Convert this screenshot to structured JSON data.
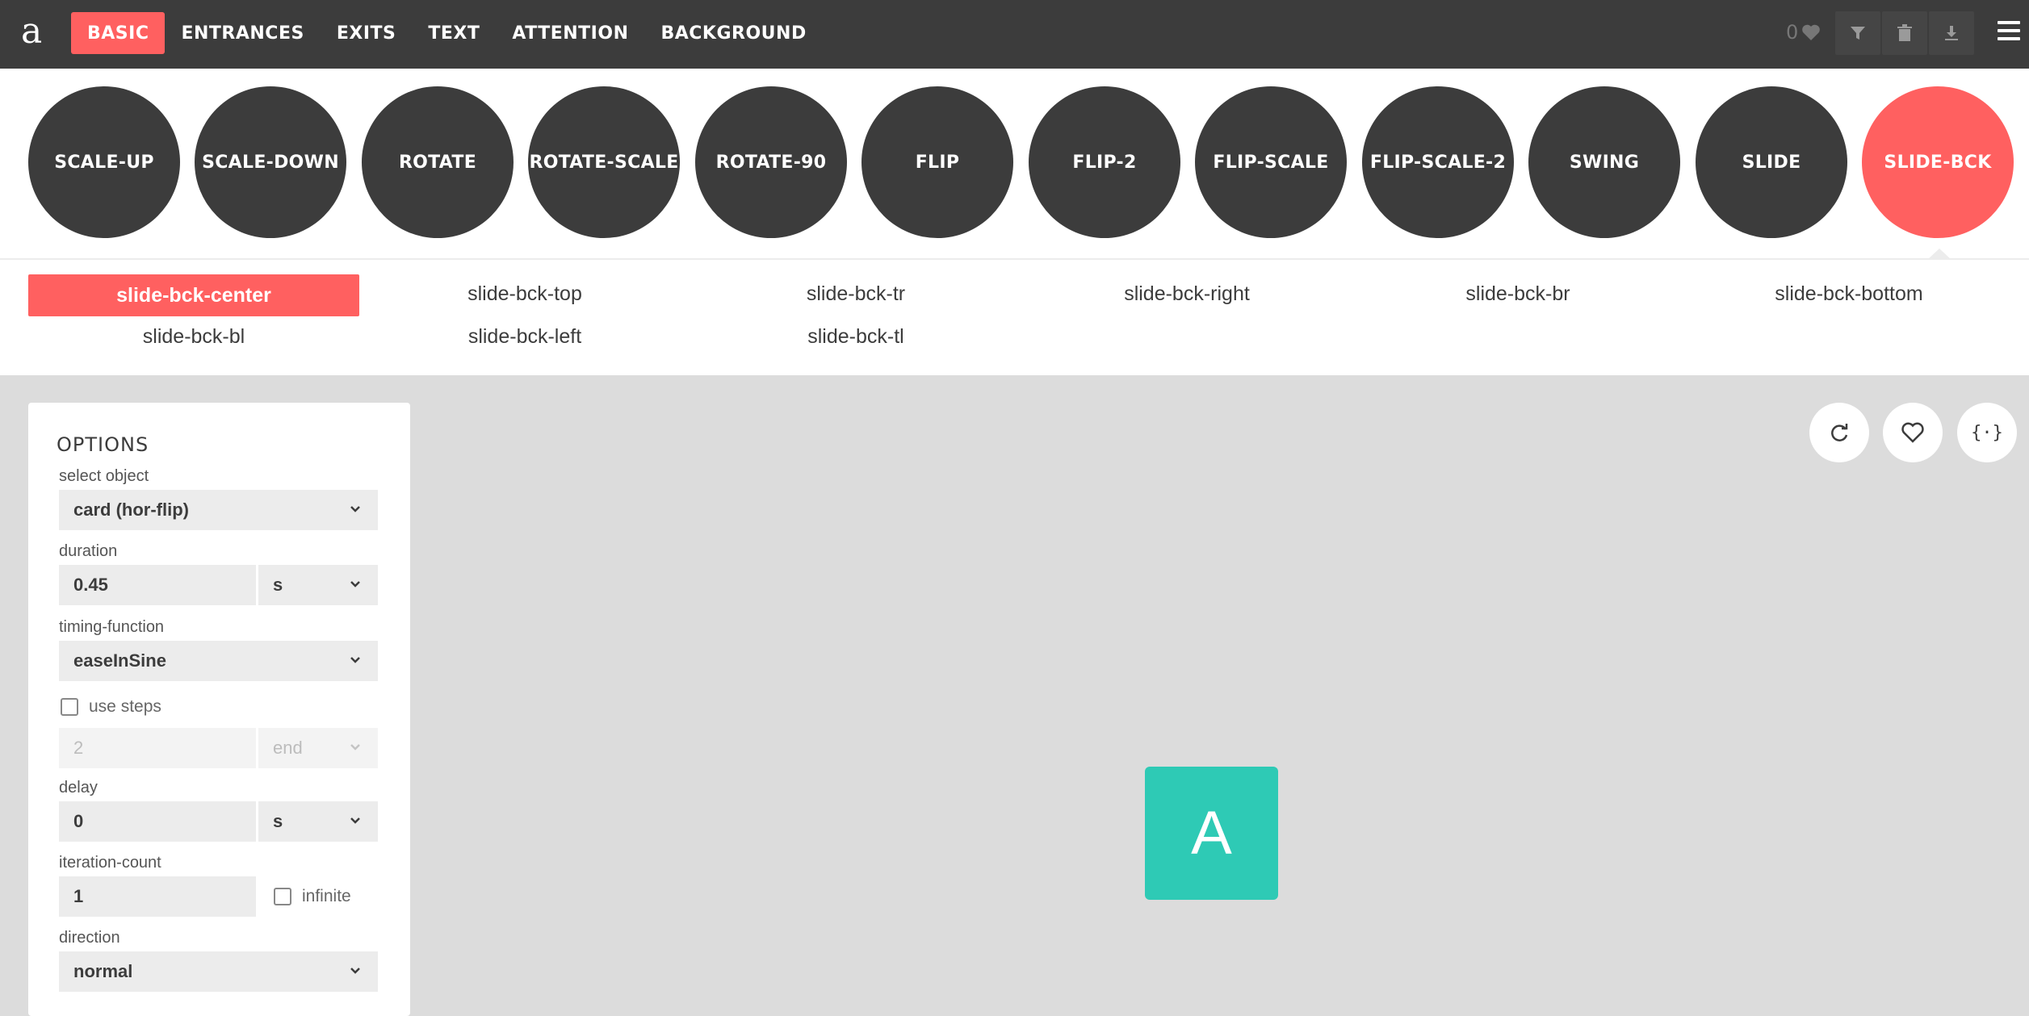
{
  "app": {
    "logo": "a"
  },
  "nav": {
    "items": [
      "BASIC",
      "ENTRANCES",
      "EXITS",
      "TEXT",
      "ATTENTION",
      "BACKGROUND"
    ],
    "active": "BASIC"
  },
  "header_tools": {
    "favorites_count": "0",
    "icons": [
      "heart-icon",
      "filter-icon",
      "trash-icon",
      "download-icon",
      "menu-icon"
    ]
  },
  "categories": {
    "items": [
      "SCALE-UP",
      "SCALE-DOWN",
      "ROTATE",
      "ROTATE-SCALE",
      "ROTATE-90",
      "FLIP",
      "FLIP-2",
      "FLIP-SCALE",
      "FLIP-SCALE-2",
      "SWING",
      "SLIDE",
      "SLIDE-BCK"
    ],
    "active": "SLIDE-BCK"
  },
  "variants": {
    "items": [
      "slide-bck-center",
      "slide-bck-top",
      "slide-bck-tr",
      "slide-bck-right",
      "slide-bck-br",
      "slide-bck-bottom",
      "slide-bck-bl",
      "slide-bck-left",
      "slide-bck-tl"
    ],
    "active": "slide-bck-center"
  },
  "options": {
    "title": "OPTIONS",
    "select_object_label": "select object",
    "select_object_value": "card (hor-flip)",
    "duration_label": "duration",
    "duration_value": "0.45",
    "duration_unit": "s",
    "timing_label": "timing-function",
    "timing_value": "easeInSine",
    "use_steps_label": "use steps",
    "use_steps_checked": false,
    "steps_value": "2",
    "steps_position": "end",
    "delay_label": "delay",
    "delay_value": "0",
    "delay_unit": "s",
    "iteration_label": "iteration-count",
    "iteration_value": "1",
    "infinite_label": "infinite",
    "infinite_checked": false,
    "direction_label": "direction",
    "direction_value": "normal"
  },
  "preview": {
    "letter": "A",
    "color": "#2ecab5"
  },
  "colors": {
    "accent": "#ff6060",
    "dark": "#3c3c3c",
    "teal": "#2ecab5"
  }
}
